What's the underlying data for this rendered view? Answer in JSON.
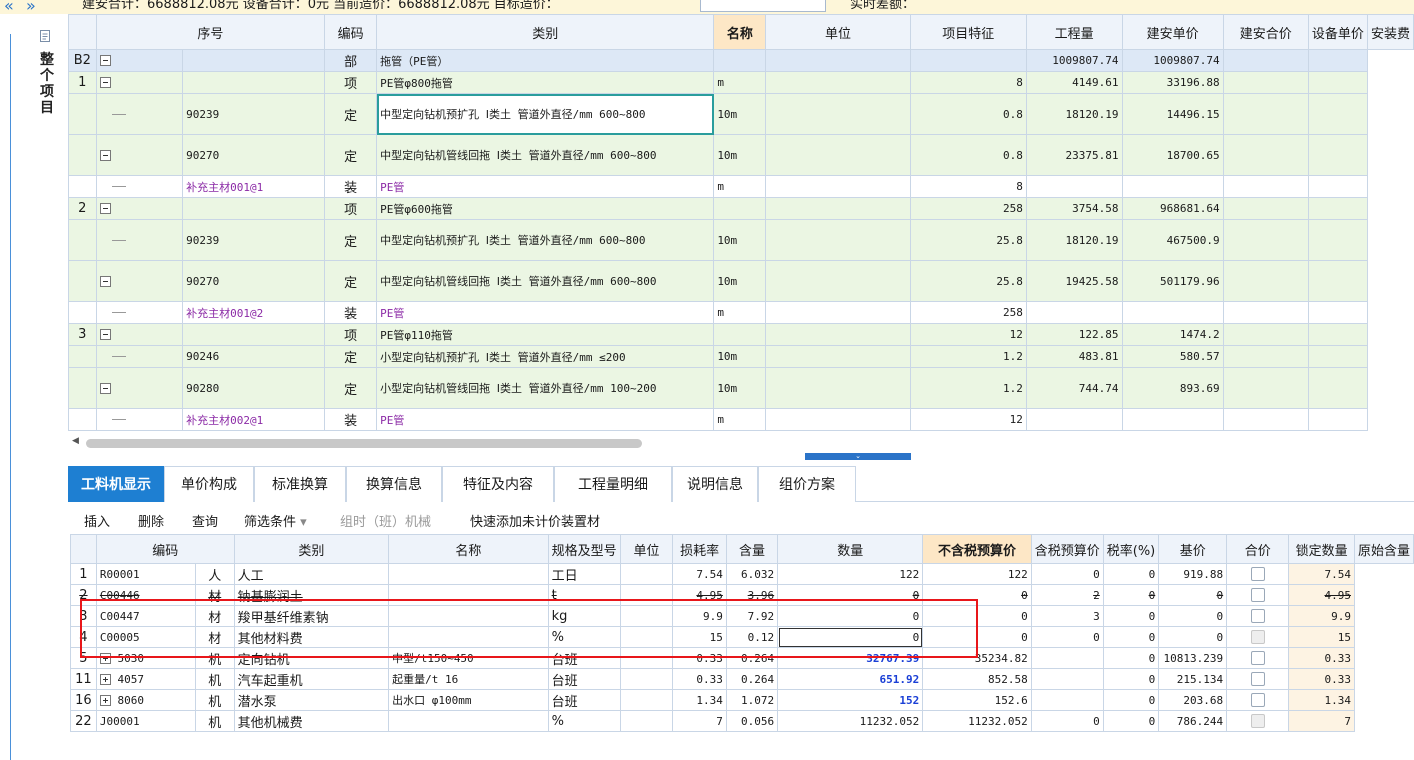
{
  "topbar": {
    "nav_prev": "«",
    "nav_next": "»",
    "summary": "建安合计：6688812.08元   设备合计：0元   当前造价：6688812.08元   目标造价：",
    "target_value": "",
    "diff_label": "实时差额："
  },
  "side": {
    "vertical_label": "整个项目",
    "icon": "document-icon"
  },
  "upper": {
    "headers": [
      "序号",
      "编码",
      "类别",
      "名称",
      "单位",
      "项目特征",
      "工程量",
      "建安单价",
      "建安合价",
      "设备单价",
      "安装费"
    ],
    "rows": [
      {
        "seq": "B2",
        "tree": "minus",
        "code": "",
        "type": "部",
        "name": "拖管（PE管）",
        "unit": "",
        "feat": "",
        "qty": "",
        "price": "1009807.74",
        "total": "1009807.74",
        "kind": "group"
      },
      {
        "seq": "1",
        "tree": "minus",
        "code": "",
        "type": "项",
        "name": "PE管φ800拖管",
        "unit": "m",
        "feat": "",
        "qty": "8",
        "price": "4149.61",
        "total": "33196.88",
        "kind": "item"
      },
      {
        "seq": "",
        "tree": "leaf",
        "code": "90239",
        "type": "定",
        "name": "中型定向钻机预扩孔 Ⅰ类土 管道外直径/mm 600~800",
        "unit": "10m",
        "feat": "",
        "qty": "0.8",
        "price": "18120.19",
        "total": "14496.15",
        "kind": "tall",
        "selected": true
      },
      {
        "seq": "",
        "tree": "minus",
        "code": "90270",
        "type": "定",
        "name": "中型定向钻机管线回拖 Ⅰ类土 管道外直径/mm 600~800",
        "unit": "10m",
        "feat": "",
        "qty": "0.8",
        "price": "23375.81",
        "total": "18700.65",
        "kind": "tall"
      },
      {
        "seq": "",
        "tree": "leaf",
        "code": "补充主材001@1",
        "type": "装",
        "name": "PE管",
        "unit": "m",
        "feat": "",
        "qty": "8",
        "price": "",
        "total": "",
        "kind": "white",
        "purple": true
      },
      {
        "seq": "2",
        "tree": "minus",
        "code": "",
        "type": "项",
        "name": "PE管φ600拖管",
        "unit": "",
        "feat": "",
        "qty": "258",
        "price": "3754.58",
        "total": "968681.64",
        "kind": "item"
      },
      {
        "seq": "",
        "tree": "leaf",
        "code": "90239",
        "type": "定",
        "name": "中型定向钻机预扩孔 Ⅰ类土 管道外直径/mm 600~800",
        "unit": "10m",
        "feat": "",
        "qty": "25.8",
        "price": "18120.19",
        "total": "467500.9",
        "kind": "tall"
      },
      {
        "seq": "",
        "tree": "minus",
        "code": "90270",
        "type": "定",
        "name": "中型定向钻机管线回拖 Ⅰ类土 管道外直径/mm 600~800",
        "unit": "10m",
        "feat": "",
        "qty": "25.8",
        "price": "19425.58",
        "total": "501179.96",
        "kind": "tall"
      },
      {
        "seq": "",
        "tree": "leaf",
        "code": "补充主材001@2",
        "type": "装",
        "name": "PE管",
        "unit": "m",
        "feat": "",
        "qty": "258",
        "price": "",
        "total": "",
        "kind": "white",
        "purple": true
      },
      {
        "seq": "3",
        "tree": "minus",
        "code": "",
        "type": "项",
        "name": "PE管φ110拖管",
        "unit": "",
        "feat": "",
        "qty": "12",
        "price": "122.85",
        "total": "1474.2",
        "kind": "item"
      },
      {
        "seq": "",
        "tree": "leaf",
        "code": "90246",
        "type": "定",
        "name": "小型定向钻机预扩孔 Ⅰ类土 管道外直径/mm ≤200",
        "unit": "10m",
        "feat": "",
        "qty": "1.2",
        "price": "483.81",
        "total": "580.57",
        "kind": "item"
      },
      {
        "seq": "",
        "tree": "minus",
        "code": "90280",
        "type": "定",
        "name": "小型定向钻机管线回拖 Ⅰ类土 管道外直径/mm 100~200",
        "unit": "10m",
        "feat": "",
        "qty": "1.2",
        "price": "744.74",
        "total": "893.69",
        "kind": "tall"
      },
      {
        "seq": "",
        "tree": "leaf",
        "code": "补充主材002@1",
        "type": "装",
        "name": "PE管",
        "unit": "m",
        "feat": "",
        "qty": "12",
        "price": "",
        "total": "",
        "kind": "white",
        "purple": true
      }
    ]
  },
  "tabs": [
    "工料机显示",
    "单价构成",
    "标准换算",
    "换算信息",
    "特征及内容",
    "工程量明细",
    "说明信息",
    "组价方案"
  ],
  "toolbar": {
    "insert": "插入",
    "delete": "删除",
    "query": "查询",
    "filter": "筛选条件",
    "filter_arrow": "▾",
    "shift_machine": "组时（班）机械",
    "quick_add": "快速添加未计价装置材"
  },
  "lower": {
    "headers": [
      "编码",
      "类别",
      "名称",
      "规格及型号",
      "单位",
      "损耗率",
      "含量",
      "数量",
      "不含税预算价",
      "含税预算价",
      "税率(%)",
      "基价",
      "合价",
      "锁定数量",
      "原始含量"
    ],
    "rows": [
      {
        "idx": "1",
        "tree": "",
        "code": "R00001",
        "type": "人",
        "name": "人工",
        "spec": "",
        "unit": "工日",
        "loss": "",
        "content": "7.54",
        "qty": "6.032",
        "price": "122",
        "taxprice": "122",
        "rate": "0",
        "base": "0",
        "total": "919.88",
        "lock_disabled": false,
        "orig": "7.54"
      },
      {
        "idx": "2",
        "tree": "",
        "code": "C00446",
        "type": "材",
        "name": "钠基膨润土",
        "spec": "",
        "unit": "t",
        "loss": "",
        "content": "4.95",
        "qty": "3.96",
        "price": "0",
        "taxprice": "0",
        "rate": "2",
        "base": "0",
        "total": "0",
        "lock_disabled": false,
        "orig": "4.95",
        "strike": true
      },
      {
        "idx": "3",
        "tree": "",
        "code": "C00447",
        "type": "材",
        "name": "羧甲基纤维素钠",
        "spec": "",
        "unit": "kg",
        "loss": "",
        "content": "9.9",
        "qty": "7.92",
        "price": "0",
        "taxprice": "0",
        "rate": "3",
        "base": "0",
        "total": "0",
        "lock_disabled": false,
        "orig": "9.9"
      },
      {
        "idx": "4",
        "tree": "",
        "code": "C00005",
        "type": "材",
        "name": "其他材料费",
        "spec": "",
        "unit": "%",
        "loss": "",
        "content": "15",
        "qty": "0.12",
        "price": "0",
        "taxprice": "0",
        "rate": "0",
        "base": "0",
        "total": "0",
        "lock_disabled": true,
        "orig": "15",
        "boxed": true
      },
      {
        "idx": "5",
        "tree": "plus",
        "code": "5030",
        "type": "机",
        "name": "定向钻机",
        "spec": "中型/t150~450",
        "unit": "台班",
        "loss": "",
        "content": "0.33",
        "qty": "0.264",
        "price": "32767.39",
        "taxprice": "35234.82",
        "rate": "",
        "base": "0",
        "total": "10813.239",
        "lock_disabled": false,
        "orig": "0.33",
        "blue": true
      },
      {
        "idx": "11",
        "tree": "plus",
        "code": "4057",
        "type": "机",
        "name": "汽车起重机",
        "spec": "起重量/t 16",
        "unit": "台班",
        "loss": "",
        "content": "0.33",
        "qty": "0.264",
        "price": "651.92",
        "taxprice": "852.58",
        "rate": "",
        "base": "0",
        "total": "215.134",
        "lock_disabled": false,
        "orig": "0.33",
        "blue": true
      },
      {
        "idx": "16",
        "tree": "plus",
        "code": "8060",
        "type": "机",
        "name": "潜水泵",
        "spec": "出水口 φ100mm",
        "unit": "台班",
        "loss": "",
        "content": "1.34",
        "qty": "1.072",
        "price": "152",
        "taxprice": "152.6",
        "rate": "",
        "base": "0",
        "total": "203.68",
        "lock_disabled": false,
        "orig": "1.34",
        "blue": true
      },
      {
        "idx": "22",
        "tree": "",
        "code": "J00001",
        "type": "机",
        "name": "其他机械费",
        "spec": "",
        "unit": "%",
        "loss": "",
        "content": "7",
        "qty": "0.056",
        "price": "11232.052",
        "taxprice": "11232.052",
        "rate": "0",
        "base": "0",
        "total": "786.244",
        "lock_disabled": true,
        "orig": "7"
      }
    ]
  },
  "colors": {
    "accent": "#1e7fd2",
    "highlight_box": "#e8161a",
    "row_green": "#ebf6e3",
    "header_orange": "#fde7c6",
    "purple_text": "#8b2aa6",
    "blue_price": "#1a3fd6"
  }
}
